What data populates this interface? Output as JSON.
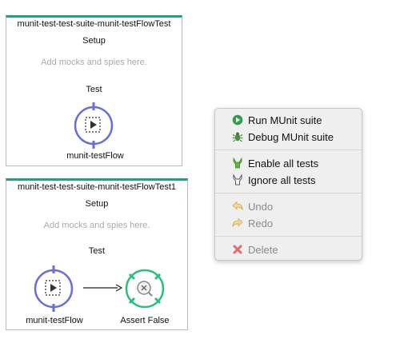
{
  "card1": {
    "title": "munit-test-test-suite-munit-testFlowTest",
    "setup_label": "Setup",
    "hint": "Add mocks and spies here.",
    "test_label": "Test",
    "flow_label": "munit-testFlow"
  },
  "card2": {
    "title": "munit-test-test-suite-munit-testFlowTest1",
    "setup_label": "Setup",
    "hint": "Add mocks and spies here.",
    "test_label": "Test",
    "flow_label": "munit-testFlow",
    "assert_label": "Assert False"
  },
  "context_menu": {
    "run": "Run MUnit suite",
    "debug": "Debug MUnit suite",
    "enable": "Enable all tests",
    "ignore": "Ignore all tests",
    "undo": "Undo",
    "redo": "Redo",
    "delete": "Delete"
  },
  "colors": {
    "card_accent": "#1aa57a",
    "flow_ref_ring": "#6a6fd6",
    "assert_ring": "#2bbf7f",
    "run_icon": "#2f9e4f",
    "delete_icon": "#e06b6b"
  },
  "icons": {
    "flow_ref": "flow-reference-icon",
    "assert": "assert-false-icon",
    "run": "run-icon",
    "debug": "bug-icon",
    "enable": "enable-tests-icon",
    "ignore": "ignore-tests-icon",
    "undo": "undo-icon",
    "redo": "redo-icon",
    "delete": "delete-icon"
  }
}
